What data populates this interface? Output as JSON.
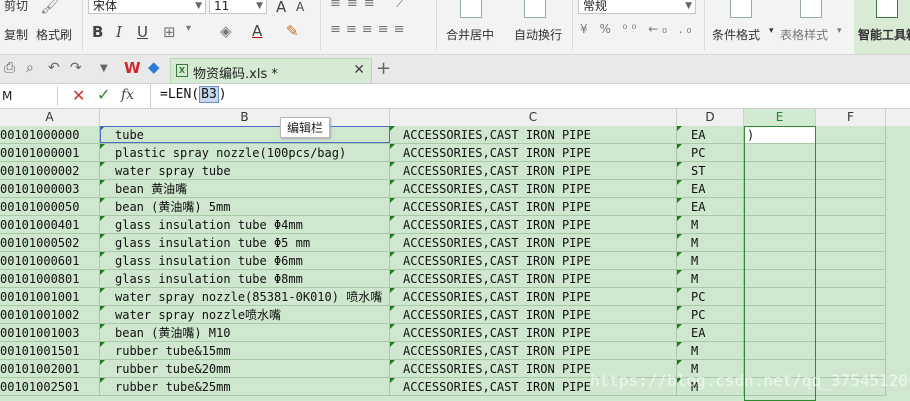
{
  "ribbon": {
    "cut": "剪切",
    "copy": "复制",
    "format_painter": "格式刷",
    "font_name": "宋体",
    "font_size": "11",
    "bold": "B",
    "italic": "I",
    "underline": "U",
    "font_color": "A",
    "increase_font": "A",
    "decrease_font": "A",
    "merge_center": "合并居中",
    "wrap_text": "自动换行",
    "number_format": "常规",
    "conditional_format": "条件格式",
    "table_style": "表格样式",
    "smart_toolbox": "智能工具箱"
  },
  "tabs": {
    "file_name": "物资编码.xls *"
  },
  "formula_bar": {
    "name_box": "M",
    "fx": "fx",
    "formula_prefix": "=LEN(",
    "formula_ref": "B3",
    "formula_suffix": ")"
  },
  "tooltip": "编辑栏",
  "columns": [
    "A",
    "B",
    "C",
    "D",
    "E",
    "F"
  ],
  "rows": [
    {
      "a": "00101000000",
      "b": "tube",
      "c": "ACCESSORIES,CAST IRON PIPE",
      "d": "EA"
    },
    {
      "a": "00101000001",
      "b": "plastic spray nozzle(100pcs/bag)",
      "c": "ACCESSORIES,CAST IRON PIPE",
      "d": "PC"
    },
    {
      "a": "00101000002",
      "b": "water spray tube",
      "c": "ACCESSORIES,CAST IRON PIPE",
      "d": "ST"
    },
    {
      "a": "00101000003",
      "b": "bean 黄油嘴",
      "c": "ACCESSORIES,CAST IRON PIPE",
      "d": "EA"
    },
    {
      "a": "00101000050",
      "b": "bean (黄油嘴) 5mm",
      "c": "ACCESSORIES,CAST IRON PIPE",
      "d": "EA"
    },
    {
      "a": "00101000401",
      "b": "glass insulation tube Φ4mm",
      "c": "ACCESSORIES,CAST IRON PIPE",
      "d": "M"
    },
    {
      "a": "00101000502",
      "b": "glass insulation tube Φ5 mm",
      "c": "ACCESSORIES,CAST IRON PIPE",
      "d": "M"
    },
    {
      "a": "00101000601",
      "b": "glass insulation tube Φ6mm",
      "c": "ACCESSORIES,CAST IRON PIPE",
      "d": "M"
    },
    {
      "a": "00101000801",
      "b": "glass insulation tube Φ8mm",
      "c": "ACCESSORIES,CAST IRON PIPE",
      "d": "M"
    },
    {
      "a": "00101001001",
      "b": "water spray nozzle(85381-0K010) 喷水嘴",
      "c": "ACCESSORIES,CAST IRON PIPE",
      "d": "PC"
    },
    {
      "a": "00101001002",
      "b": "water spray nozzle喷水嘴",
      "c": "ACCESSORIES,CAST IRON PIPE",
      "d": "PC"
    },
    {
      "a": "00101001003",
      "b": "bean (黄油嘴) M10",
      "c": "ACCESSORIES,CAST IRON PIPE",
      "d": "EA"
    },
    {
      "a": "00101001501",
      "b": "rubber tube&15mm",
      "c": "ACCESSORIES,CAST IRON PIPE",
      "d": "M"
    },
    {
      "a": "00101002001",
      "b": "rubber tube&20mm",
      "c": "ACCESSORIES,CAST IRON PIPE",
      "d": "M"
    },
    {
      "a": "00101002501",
      "b": "rubber tube&25mm",
      "c": "ACCESSORIES,CAST IRON PIPE",
      "d": "M"
    }
  ],
  "editing_cell": {
    "column": "E",
    "value": ")"
  },
  "watermark": "https://blog.csdn.net/qq_37545120",
  "colors": {
    "grid_bg": "#cfe7cf",
    "accent": "#2f8a2f",
    "selection": "#4a6fc4"
  }
}
